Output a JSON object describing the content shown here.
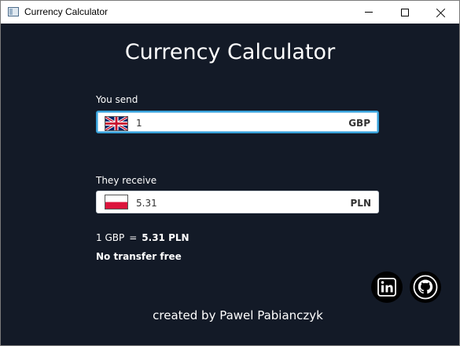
{
  "window": {
    "title": "Currency Calculator"
  },
  "main": {
    "heading": "Currency Calculator",
    "send": {
      "label": "You send",
      "value": "1",
      "currency": "GBP",
      "flag": "united-kingdom-flag"
    },
    "receive": {
      "label": "They receive",
      "value": "5.31",
      "currency": "PLN",
      "flag": "poland-flag"
    },
    "rate": {
      "from": "1 GBP",
      "equals": "=",
      "to": "5.31 PLN"
    },
    "fee_note": "No transfer free",
    "social": {
      "linkedin_icon": "linkedin-icon",
      "github_icon": "github-icon"
    },
    "footer": "created by Pawel Pabianczyk"
  },
  "colors": {
    "background": "#131a27",
    "focus_border": "#37a0d8",
    "text": "#ffffff"
  }
}
